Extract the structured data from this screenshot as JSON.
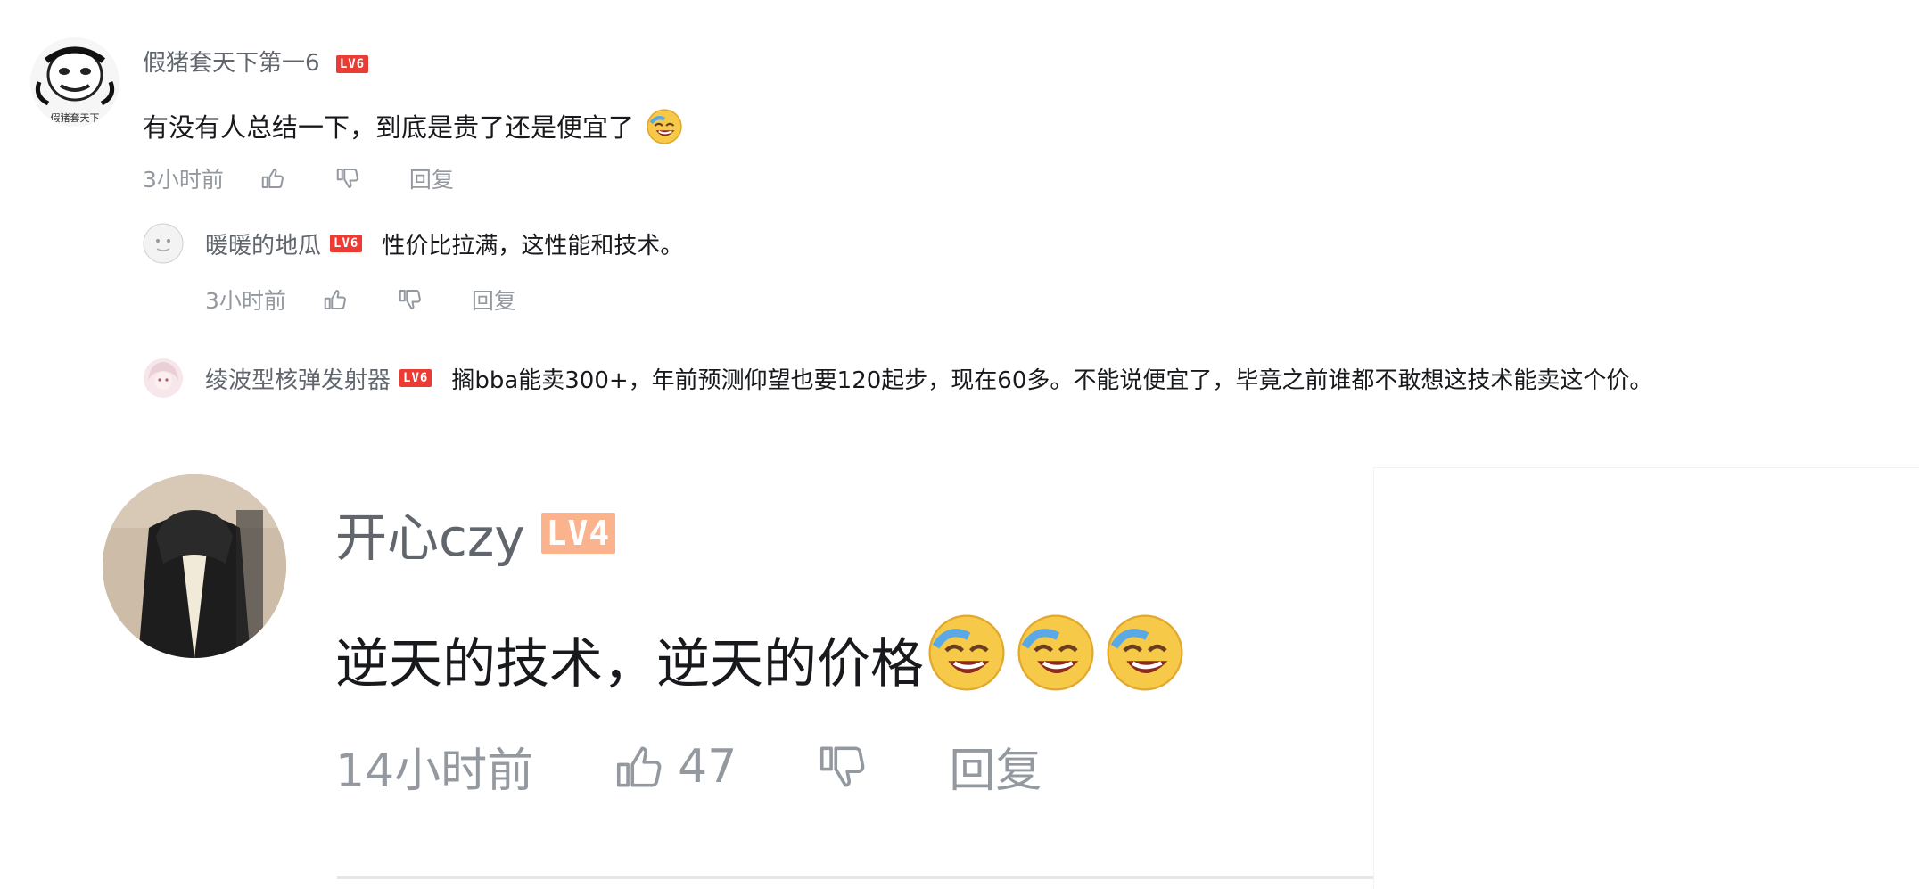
{
  "top_thread": {
    "comment": {
      "username": "假猪套天下第一6",
      "level_badge": "LV6",
      "avatar_caption": "假猪套天下",
      "text": "有没有人总结一下，到底是贵了还是便宜了",
      "time": "3小时前",
      "reply_label": "回复"
    },
    "replies": [
      {
        "username": "暖暖的地瓜",
        "level_badge": "LV6",
        "text": "性价比拉满，这性能和技术。",
        "time": "3小时前",
        "reply_label": "回复"
      },
      {
        "username": "绫波型核弹发射器",
        "level_badge": "LV6",
        "text": "搁bba能卖300+，年前预测仰望也要120起步，现在60多。不能说便宜了，毕竟之前谁都不敢想这技术能卖这个价。"
      }
    ]
  },
  "big_comment": {
    "username": "开心czy",
    "level_badge": "LV4",
    "text": "逆天的技术，逆天的价格",
    "time": "14小时前",
    "like_count": "47",
    "reply_label": "回复"
  },
  "colors": {
    "username": "#61666d",
    "text": "#18191c",
    "meta": "#9499a0",
    "badge_lv6": "#ea3c35",
    "badge_lv4": "#fbb38d",
    "emoji_face": "#f7c948"
  },
  "icons": {
    "like": "thumbs-up-icon",
    "dislike": "thumbs-down-icon",
    "emoji": "laugh-cry-emoji"
  }
}
